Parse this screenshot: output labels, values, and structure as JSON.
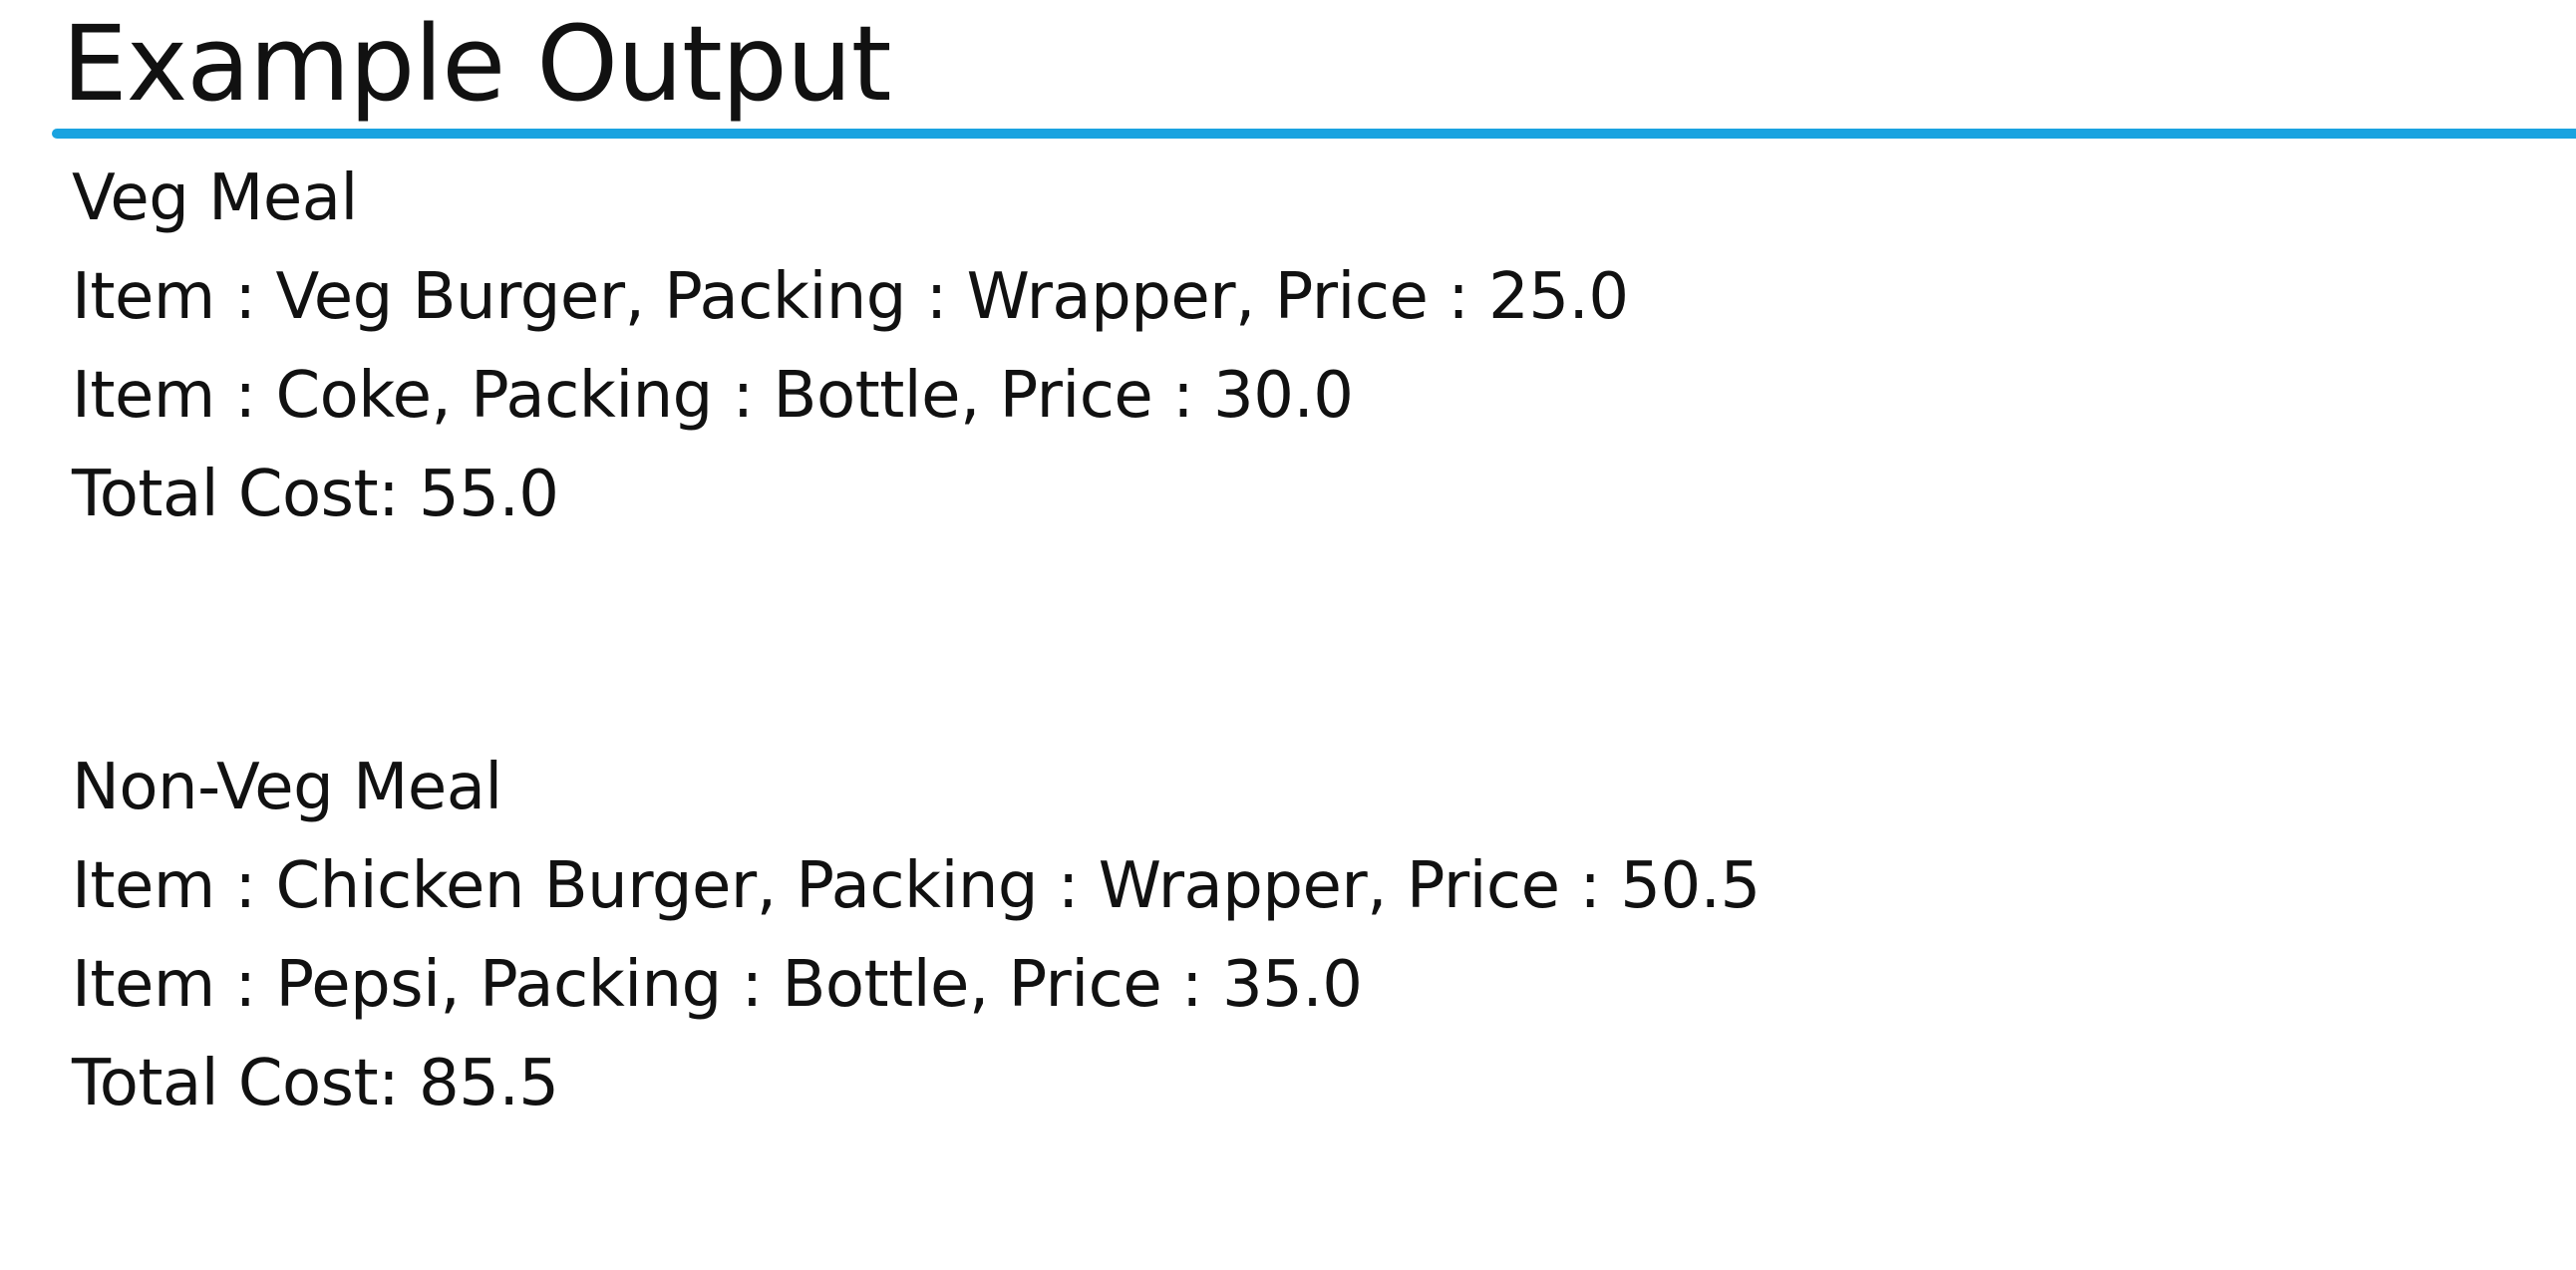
{
  "title": "Example Output",
  "colors": {
    "accent": "#1aa3e0",
    "text": "#111111"
  },
  "meals": [
    {
      "name": "Veg Meal",
      "items": [
        "Item : Veg Burger, Packing : Wrapper, Price : 25.0",
        "Item : Coke, Packing : Bottle, Price : 30.0"
      ],
      "total": "Total Cost: 55.0"
    },
    {
      "name": "Non-Veg Meal",
      "items": [
        "Item : Chicken Burger, Packing : Wrapper, Price : 50.5",
        "Item : Pepsi, Packing : Bottle, Price : 35.0"
      ],
      "total": "Total Cost: 85.5"
    }
  ]
}
